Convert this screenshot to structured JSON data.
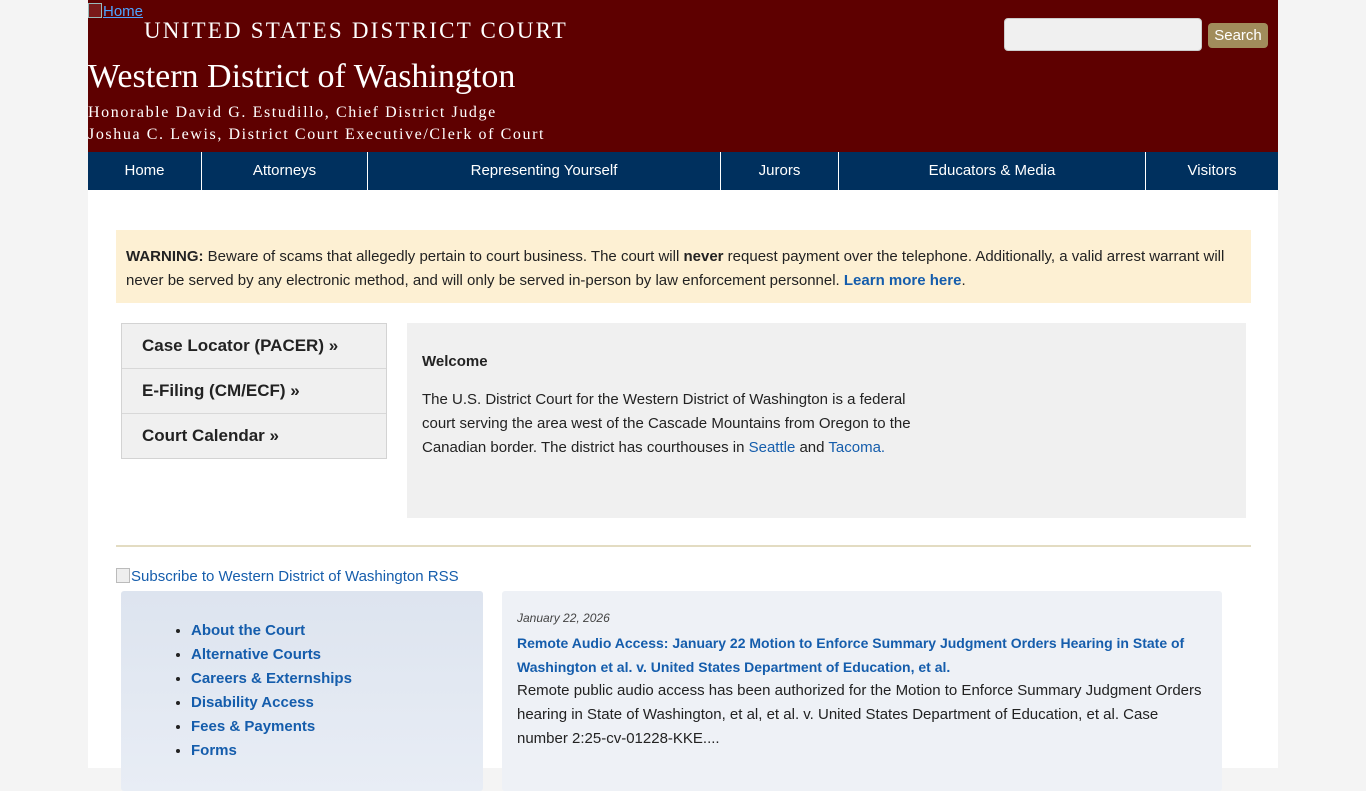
{
  "header": {
    "home_alt": "Home",
    "court_line": "UNITED STATES DISTRICT COURT",
    "district": "Western District of Washington",
    "judge": "Honorable David G. Estudillo, Chief District Judge",
    "clerk": "Joshua C. Lewis, District Court Executive/Clerk of Court",
    "search_value": "",
    "search_button": "Search"
  },
  "nav": {
    "items": [
      "Home",
      "Attorneys",
      "Representing Yourself",
      "Jurors",
      "Educators & Media",
      "Visitors"
    ]
  },
  "warning": {
    "label": "WARNING:",
    "text1": " Beware of scams that allegedly pertain to court business. The court will ",
    "emphasis": "never",
    "text2": " request payment over the telephone. Additionally, a valid arrest warrant will never be served by any electronic method, and will only be served in-person by law enforcement personnel. ",
    "link": "Learn more here",
    "end": "."
  },
  "quick_links": [
    "Case Locator (PACER) »",
    "E-Filing (CM/ECF) »",
    "Court Calendar »"
  ],
  "welcome": {
    "title": "Welcome",
    "text1": "The U.S. District Court for the Western District of Washington is a federal court serving the area west of the Cascade Mountains from Oregon to the Canadian border. The district has courthouses in ",
    "link1": "Seattle",
    "text2": " and ",
    "link2": "Tacoma",
    "text3": "."
  },
  "rss_alt": "Subscribe to Western District of Washington RSS",
  "sidebar_links": [
    "About the Court",
    "Alternative Courts",
    "Careers & Externships",
    "Disability Access",
    "Fees & Payments",
    "Forms"
  ],
  "news": {
    "date": "January 22, 2026",
    "title": "Remote Audio Access: January 22 Motion to Enforce Summary Judgment Orders Hearing in State of Washington et al. v. United States Department of Education, et al.",
    "body": "Remote public audio access has been authorized for the Motion to Enforce Summary Judgment Orders hearing in State of Washington, et al, et al. v. United States Department of Education, et al. Case number 2:25-cv-01228-KKE...."
  },
  "colors": {
    "header_bg": "#5e0000",
    "nav_bg": "#00305e",
    "warning_bg": "#fdf0d3",
    "link": "#155dac",
    "search_button_bg": "#a18c5b"
  }
}
